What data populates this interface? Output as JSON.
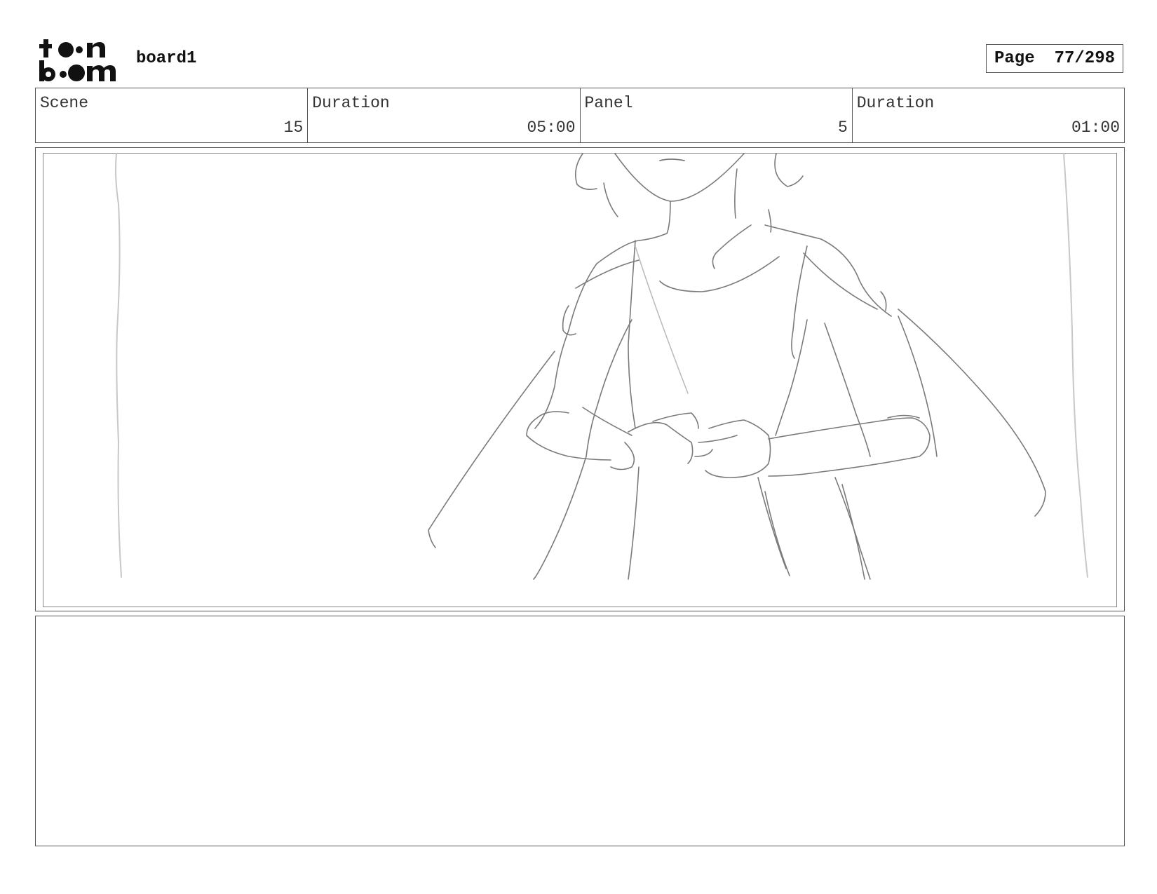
{
  "header": {
    "logo_text": "toon boom",
    "board_name": "board1",
    "page_label": "Page",
    "page_number": "77/298"
  },
  "info": {
    "scene_label": "Scene",
    "scene_value": "15",
    "scene_duration_label": "Duration",
    "scene_duration_value": "05:00",
    "panel_label": "Panel",
    "panel_value": "5",
    "panel_duration_label": "Duration",
    "panel_duration_value": "01:00"
  },
  "panel_image": {
    "description_icon": "storyboard-sketch"
  },
  "notes": {
    "text": ""
  },
  "colors": {
    "border": "#555555",
    "sketch": "#777777"
  }
}
